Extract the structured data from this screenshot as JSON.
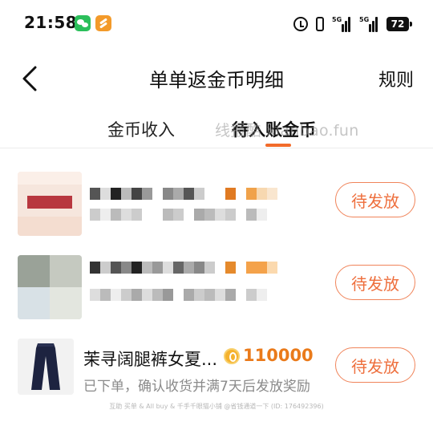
{
  "status_bar": {
    "time": "21:58",
    "net1": "5G",
    "net2": "5G",
    "battery": "72",
    "icons": [
      "wechat-icon",
      "orange-app-icon",
      "alarm-icon",
      "vibrate-icon",
      "signal-icon",
      "signal-icon",
      "battery-icon"
    ]
  },
  "nav": {
    "title": "单单返金币明细",
    "rules_label": "规则",
    "back_icon": "chevron-left-icon"
  },
  "tabs": [
    {
      "label": "金币收入",
      "active": false
    },
    {
      "label": "待入账金币",
      "active": true
    }
  ],
  "watermark": "线报酷 xianbao.fun",
  "items": [
    {
      "title": "",
      "desc": "",
      "amount": "",
      "action_label": "待发放"
    },
    {
      "title": "",
      "desc": "",
      "amount": "",
      "action_label": "待发放"
    },
    {
      "title": "茉寻阔腿裤女夏...",
      "amount": "110000",
      "desc": "已下单，确认收货并满7天后发放奖励",
      "action_label": "待发放"
    }
  ],
  "footer_text": "互助 买单 & All buy & 千手千眼猫小铺 @省钱通道一下 (ID: 176492396)",
  "colors": {
    "accent": "#ee6f3d",
    "coin": "#ea7a1a",
    "indicator": "#f26b2a"
  }
}
